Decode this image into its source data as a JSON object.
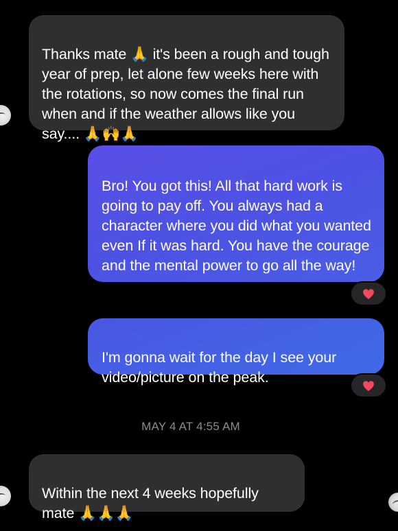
{
  "messages": [
    {
      "direction": "incoming",
      "text": "Thanks mate 🙏 it's been a rough and tough year of prep, let alone few weeks here with the rotations, so now comes the final run when and if the weather allows like you say.... 🙏🙌🙏"
    },
    {
      "direction": "outgoing",
      "text": "Bro! You got this! All that hard work is going to pay off.  You always had a character where you did what you wanted even If it was hard.   You have the courage and the mental power to go all the way!",
      "reaction": "heart-icon"
    },
    {
      "direction": "outgoing",
      "text": "I'm gonna wait for the day I see your video/picture on the peak.",
      "reaction": "heart-icon"
    },
    {
      "direction": "incoming",
      "text": "Within the next 4 weeks hopefully mate 🙏🙏🙏"
    }
  ],
  "timestamp": "MAY 4 AT 4:55 AM",
  "colors": {
    "background": "#000000",
    "incoming_bubble": "#2f2f31",
    "outgoing_bubble": "#4d55e4",
    "reaction_heart": "#f2495e",
    "timestamp_text": "#8c8c8c"
  }
}
